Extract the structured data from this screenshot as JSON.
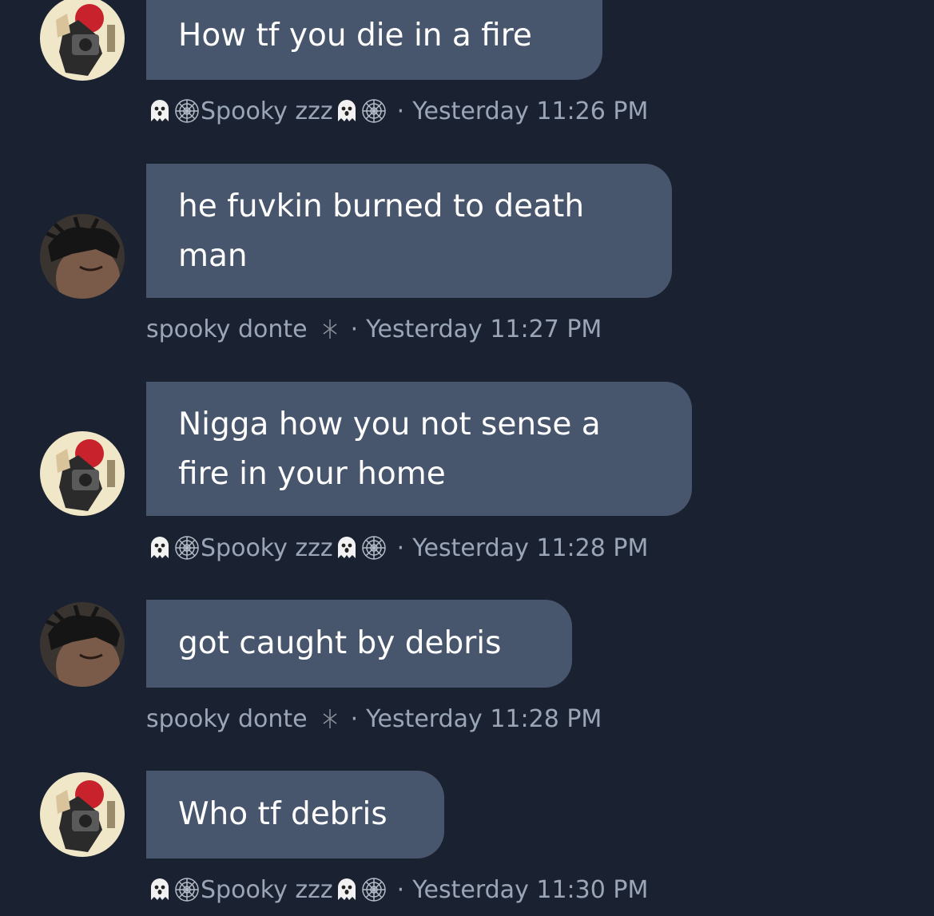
{
  "messages": [
    {
      "author": "zzz",
      "text_lines": [
        "How tf you die in a fire"
      ],
      "name": "Spooky zzz",
      "timestamp": "Yesterday 11:26 PM"
    },
    {
      "author": "donte",
      "text_lines": [
        "he fuvkin burned to death",
        "man"
      ],
      "name": "spooky donte",
      "timestamp": "Yesterday 11:27 PM"
    },
    {
      "author": "zzz",
      "text_lines": [
        "Nigga how you not sense a",
        "fire in your home"
      ],
      "name": "Spooky zzz",
      "timestamp": "Yesterday 11:28 PM"
    },
    {
      "author": "donte",
      "text_lines": [
        "got caught by debris"
      ],
      "name": "spooky donte",
      "timestamp": "Yesterday 11:28 PM"
    },
    {
      "author": "zzz",
      "text_lines": [
        "Who tf debris"
      ],
      "name": "Spooky zzz",
      "timestamp": "Yesterday 11:30 PM"
    }
  ],
  "separator": "·",
  "icons": {
    "zzz_name_prefix": [
      "ghost-icon",
      "spiderweb-icon"
    ],
    "zzz_name_suffix": [
      "ghost-icon",
      "spiderweb-icon"
    ],
    "donte_name_suffix": "sparkle-icon"
  },
  "colors": {
    "background": "#1a2231",
    "bubble": "#48566d",
    "meta_text": "#9aa6b8",
    "message_text": "#ffffff"
  }
}
